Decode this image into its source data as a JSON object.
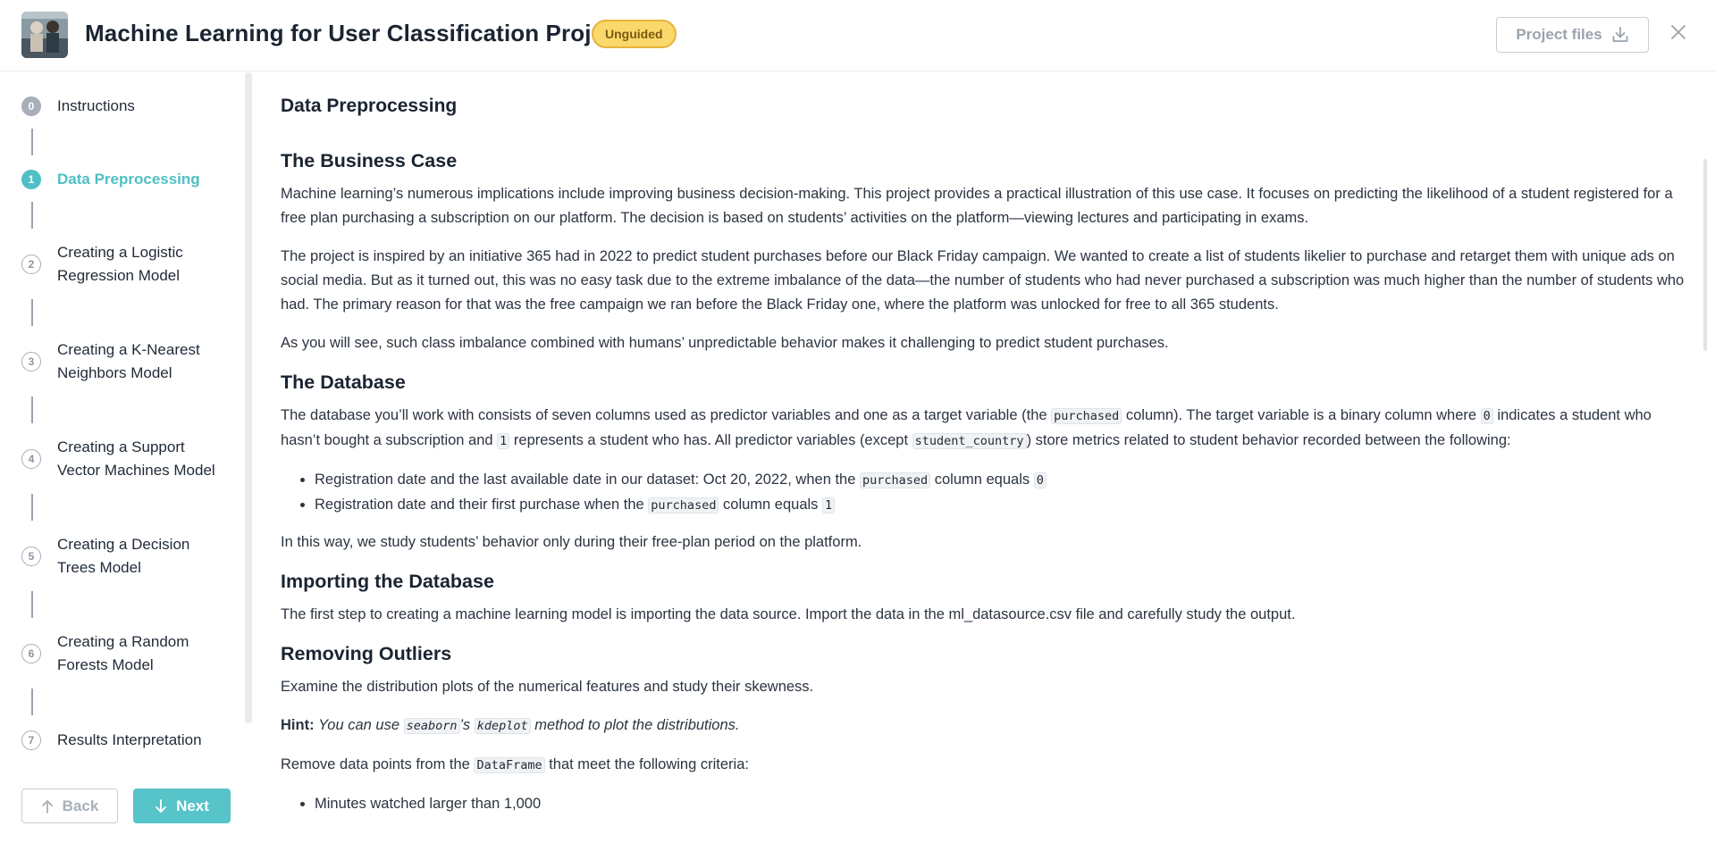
{
  "header": {
    "title": "Machine Learning for User Classification Project",
    "badge": "Unguided",
    "project_files_label": "Project files",
    "download_icon": "download-icon",
    "close_icon": "close-icon"
  },
  "sidebar": {
    "steps": [
      {
        "num": "0",
        "label": "Instructions"
      },
      {
        "num": "1",
        "label": "Data Preprocessing"
      },
      {
        "num": "2",
        "label": "Creating a Logistic Regression Model"
      },
      {
        "num": "3",
        "label": "Creating a K-Nearest Neighbors Model"
      },
      {
        "num": "4",
        "label": "Creating a Support Vector Machines Model"
      },
      {
        "num": "5",
        "label": "Creating a Decision Trees Model"
      },
      {
        "num": "6",
        "label": "Creating a Random Forests Model"
      },
      {
        "num": "7",
        "label": "Results Interpretation"
      }
    ],
    "back_label": "Back",
    "next_label": "Next"
  },
  "main": {
    "page_title": "Data Preprocessing",
    "business_case": {
      "heading": "The Business Case",
      "p1": "Machine learning’s numerous implications include improving business decision-making. This project provides a practical illustration of this use case. It focuses on predicting the likelihood of a student registered for a free plan purchasing a subscription on our platform. The decision is based on students’ activities on the platform—viewing lectures and participating in exams.",
      "p2": "The project is inspired by an initiative 365 had in 2022 to predict student purchases before our Black Friday campaign. We wanted to create a list of students likelier to purchase and retarget them with unique ads on social media. But as it turned out, this was no easy task due to the extreme imbalance of the data—the number of students who had never purchased a subscription was much higher than the number of students who had. The primary reason for that was the free campaign we ran before the Black Friday one, where the platform was unlocked for free to all 365 students.",
      "p3": "As you will see, such class imbalance combined with humans’ unpredictable behavior makes it challenging to predict student purchases."
    },
    "database": {
      "heading": "The Database",
      "p1_a": "The database you’ll work with consists of seven columns used as predictor variables and one as a target variable (the ",
      "p1_code1": "purchased",
      "p1_b": " column). The target variable is a binary column where ",
      "p1_code2": "0",
      "p1_c": " indicates a student who hasn’t bought a subscription and ",
      "p1_code3": "1",
      "p1_d": " represents a student who has. All predictor variables (except ",
      "p1_code4": "student_country",
      "p1_e": ") store metrics related to student behavior recorded between the following:",
      "li1_a": "Registration date and the last available date in our dataset: Oct 20, 2022, when the ",
      "li1_code1": "purchased",
      "li1_b": " column equals ",
      "li1_code2": "0",
      "li2_a": "Registration date and their first purchase when the ",
      "li2_code1": "purchased",
      "li2_b": " column equals ",
      "li2_code2": "1",
      "p2": "In this way, we study students’ behavior only during their free-plan period on the platform."
    },
    "importing": {
      "heading": "Importing the Database",
      "p1": "The first step to creating a machine learning model is importing the data source. Import the data in the ml_datasource.csv file and carefully study the output."
    },
    "outliers": {
      "heading": "Removing Outliers",
      "p1": "Examine the distribution plots of the numerical features and study their skewness.",
      "hint_label": "Hint:",
      "hint_a": "You can use ",
      "hint_code1": "seaborn",
      "hint_b": "’s ",
      "hint_code2": "kdeplot",
      "hint_c": " method to plot the distributions.",
      "p2_a": "Remove data points from the ",
      "p2_code": "DataFrame",
      "p2_b": " that meet the following criteria:",
      "li1": "Minutes watched larger than 1,000"
    }
  }
}
